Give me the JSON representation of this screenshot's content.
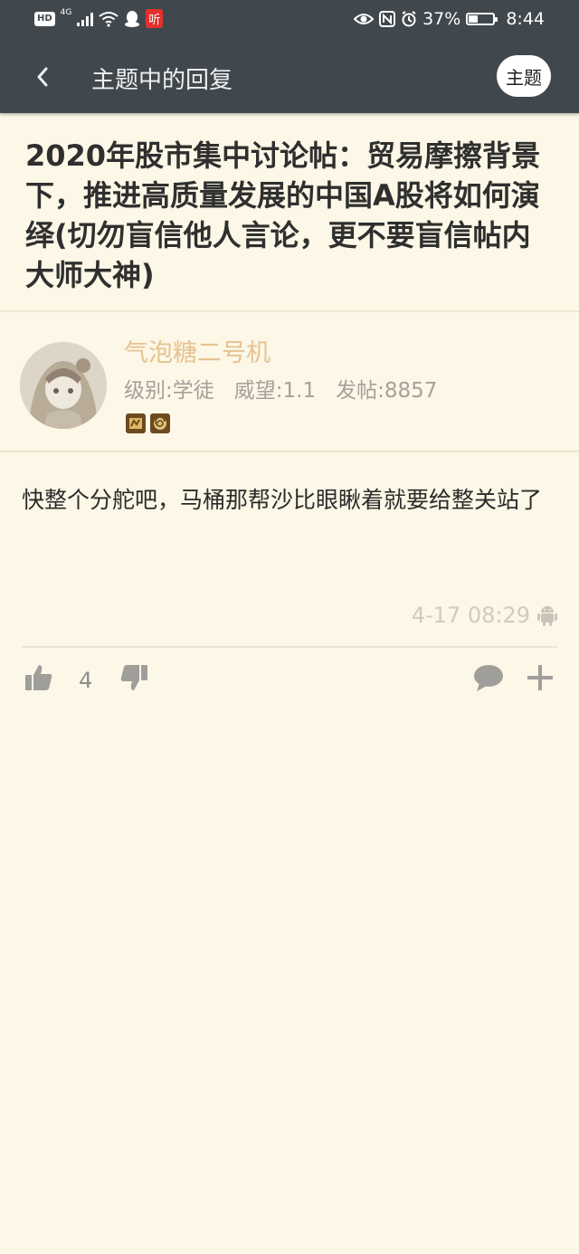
{
  "status_bar": {
    "hd_label": "HD",
    "network": "4G",
    "listen_badge": "听",
    "battery": "37%",
    "battery_level": 0.37,
    "time": "8:44"
  },
  "app_bar": {
    "title": "主题中的回复",
    "topic_button": "主题"
  },
  "thread": {
    "title": "2020年股市集中讨论帖：贸易摩擦背景下，推进高质量发展的中国A股将如何演绎(切勿盲信他人言论，更不要盲信帖内大师大神)"
  },
  "author": {
    "name": "气泡糖二号机",
    "level": "级别:学徒",
    "prestige": "威望:1.1",
    "posts": "发帖:8857"
  },
  "post": {
    "content": "快整个分舵吧，马桶那帮沙比眼瞅着就要给整关站了",
    "time": "4-17 08:29"
  },
  "actions": {
    "like_count": "4"
  },
  "colors": {
    "background": "#fcf7e6",
    "app_bar": "#41484d",
    "username": "#e6c291",
    "icon_gray": "#a09e9a"
  }
}
